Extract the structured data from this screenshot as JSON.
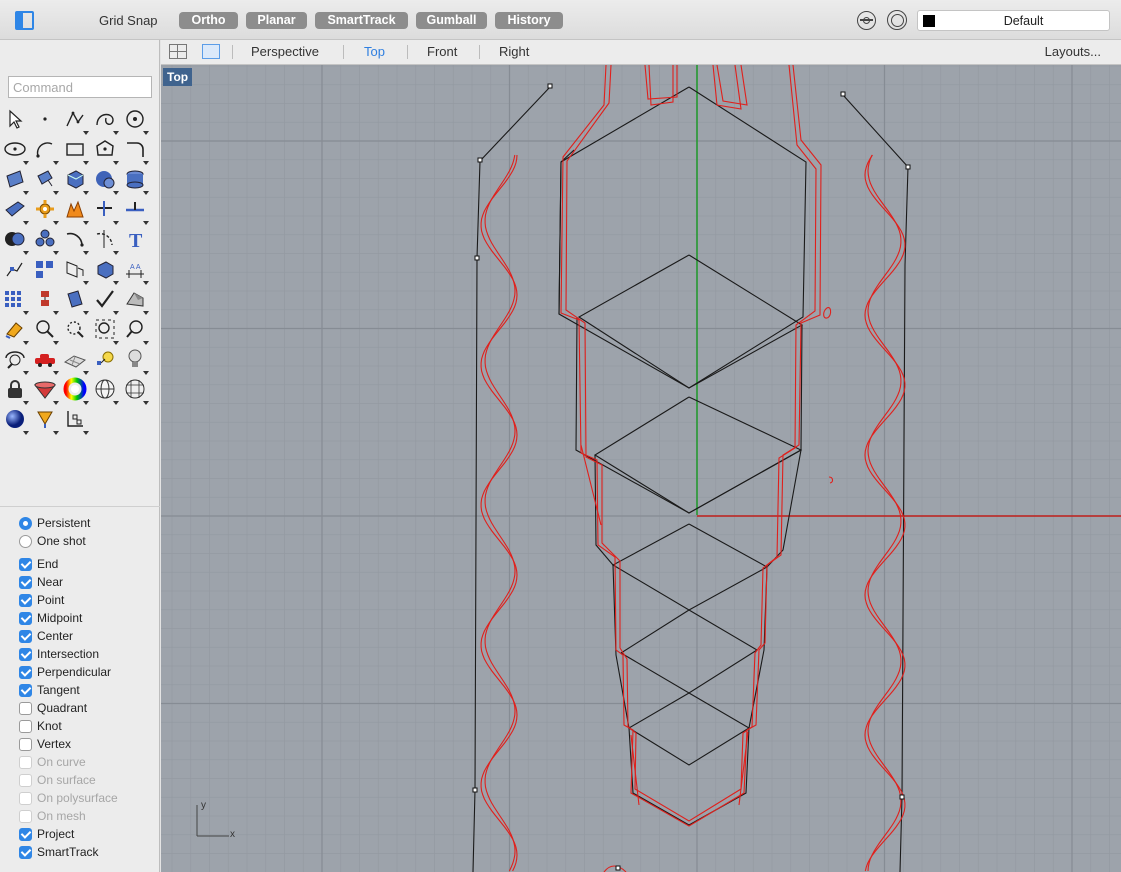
{
  "toolbar": {
    "grid_snap": "Grid Snap",
    "modes": [
      "Ortho",
      "Planar",
      "SmartTrack",
      "Gumball",
      "History"
    ],
    "layer": "Default",
    "layer_color": "#000000"
  },
  "viewtabs": {
    "tabs": [
      "Perspective",
      "Top",
      "Front",
      "Right"
    ],
    "active": "Top",
    "layouts": "Layouts..."
  },
  "command": {
    "placeholder": "Command",
    "value": ""
  },
  "viewport": {
    "label": "Top",
    "axis_x": "x",
    "axis_y": "y",
    "background": "#9da3ab",
    "curve_color": "#e0201c",
    "outline_color": "#1a1a1a"
  },
  "tools": [
    "select-arrow-icon",
    "point-icon",
    "polyline-icon",
    "curve-icon",
    "circle-icon",
    "ellipse-icon",
    "arc-icon",
    "rectangle-icon",
    "polygon-icon",
    "curve-fillet-icon",
    "surface-icon",
    "extrude-icon",
    "box-icon",
    "sphere-icon",
    "cylinder-icon",
    "plane-surface-icon",
    "gear-icon",
    "explode-icon",
    "trim-icon",
    "split-icon",
    "boolean-icon",
    "group-icon",
    "rotate-icon",
    "mirror-icon",
    "text-icon",
    "snap-icon",
    "array-icon",
    "scale-icon",
    "solid-edit-icon",
    "dimension-icon",
    "grid-icon",
    "layer-icon",
    "transform-icon",
    "check-icon",
    "render-icon",
    "paint-icon",
    "zoom-icon",
    "zoom-window-icon",
    "zoom-extents-icon",
    "zoom-magnifier-icon",
    "rotate-view-icon",
    "car-icon",
    "map-icon",
    "light-icon",
    "bulb-icon",
    "lock-icon",
    "material-icon",
    "color-wheel-icon",
    "sphere-wire-icon",
    "globe-grid-icon",
    "shaded-sphere-icon",
    "pencil-icon",
    "coordinate-icon"
  ],
  "osnap": {
    "modes": [
      {
        "label": "Persistent",
        "checked": true
      },
      {
        "label": "One shot",
        "checked": false
      }
    ],
    "snaps": [
      {
        "label": "End",
        "checked": true,
        "enabled": true
      },
      {
        "label": "Near",
        "checked": true,
        "enabled": true
      },
      {
        "label": "Point",
        "checked": true,
        "enabled": true
      },
      {
        "label": "Midpoint",
        "checked": true,
        "enabled": true
      },
      {
        "label": "Center",
        "checked": true,
        "enabled": true
      },
      {
        "label": "Intersection",
        "checked": true,
        "enabled": true
      },
      {
        "label": "Perpendicular",
        "checked": true,
        "enabled": true
      },
      {
        "label": "Tangent",
        "checked": true,
        "enabled": true
      },
      {
        "label": "Quadrant",
        "checked": false,
        "enabled": true
      },
      {
        "label": "Knot",
        "checked": false,
        "enabled": true
      },
      {
        "label": "Vertex",
        "checked": false,
        "enabled": true
      },
      {
        "label": "On curve",
        "checked": false,
        "enabled": false
      },
      {
        "label": "On surface",
        "checked": false,
        "enabled": false
      },
      {
        "label": "On polysurface",
        "checked": false,
        "enabled": false
      },
      {
        "label": "On mesh",
        "checked": false,
        "enabled": false
      },
      {
        "label": "Project",
        "checked": true,
        "enabled": true
      },
      {
        "label": "SmartTrack",
        "checked": true,
        "enabled": true
      }
    ]
  }
}
